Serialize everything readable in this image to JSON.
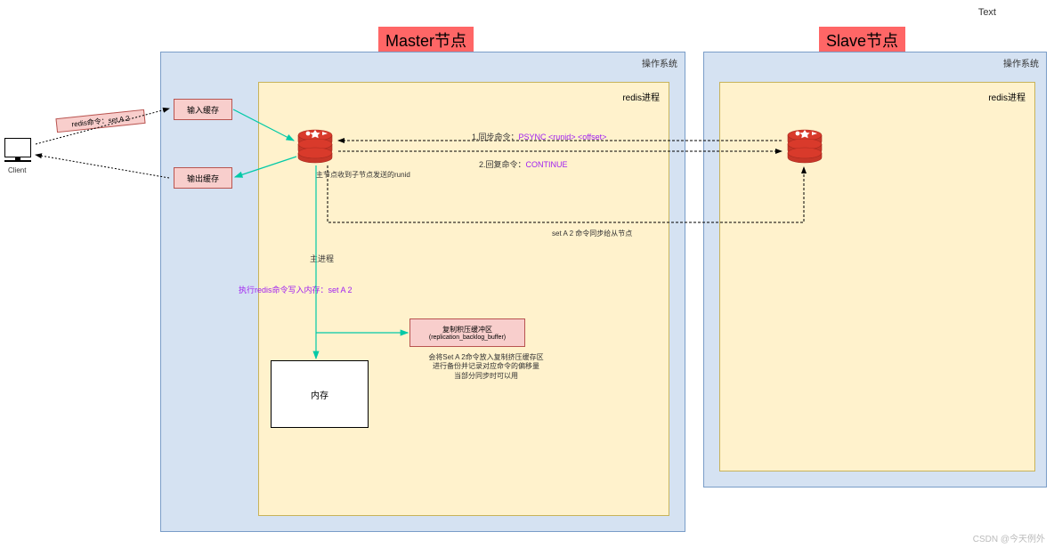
{
  "topRightText": "Text",
  "masterTitle": "Master节点",
  "slaveTitle": "Slave节点",
  "osLabel": "操作系统",
  "processLabel": "redis进程",
  "client": {
    "label": "Client",
    "command": "redis命令：set A 2"
  },
  "buffers": {
    "input": "输入缓存",
    "output": "输出缓存"
  },
  "memoryLabel": "内存",
  "backlog": {
    "line1": "复制积压缓冲区",
    "line2": "(replication_backlog_buffer)"
  },
  "labels": {
    "runid": "主节点收到子节点发送的runid",
    "mainProcess": "主进程",
    "execute": "执行redis命令写入内存：set A 2",
    "syncPrefix": "1.同步命令：",
    "syncCmd": "PSYNC <runid> <offset>",
    "replyPrefix": "2.回复命令：",
    "replyCmd": "CONTINUE",
    "setSync": "set A 2 命令同步给从节点",
    "backlogNote1": "会将Set A 2命令放入复制挤压缓存区",
    "backlogNote2": "进行备份并记录对应命令的偏移量",
    "backlogNote3": "当部分同步时可以用"
  },
  "watermark": "CSDN @今天例外"
}
